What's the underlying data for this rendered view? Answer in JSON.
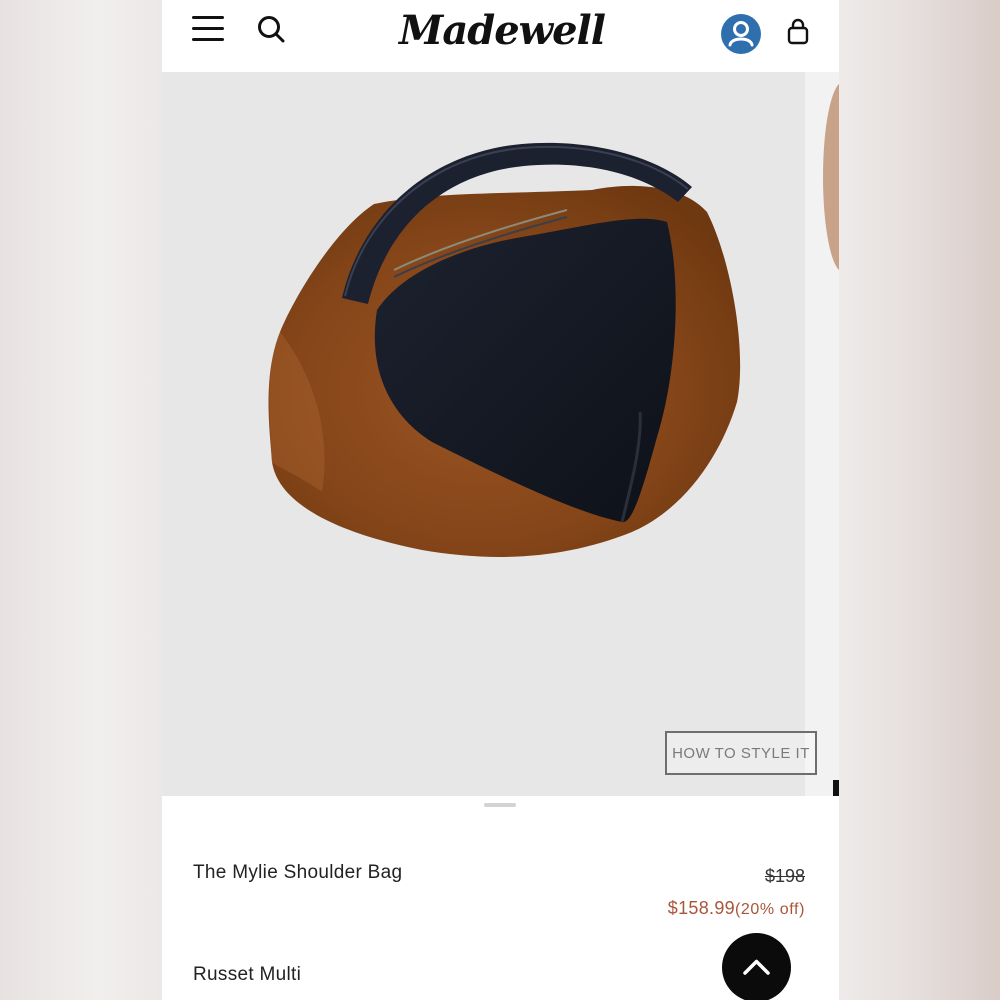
{
  "brand": {
    "name": "Madewell"
  },
  "header": {
    "menu_icon": "hamburger-menu-icon",
    "search_icon": "search-icon",
    "account_icon": "user-account-icon",
    "bag_icon": "shopping-bag-icon",
    "account_color": "#2f6fae"
  },
  "hero": {
    "style_button_label": "HOW TO STYLE IT",
    "background_color": "#e8e7e8"
  },
  "product": {
    "name": "The Mylie Shoulder Bag",
    "original_price": "$198",
    "sale_price": "$158.99",
    "discount": "(20% off)",
    "color": "Russet Multi"
  },
  "colors": {
    "sale_price": "#a8563a",
    "suede": "#8a4a1f",
    "scroll_top_button": "#0b0b0b"
  },
  "scroll_top": {
    "icon": "chevron-up-icon"
  }
}
